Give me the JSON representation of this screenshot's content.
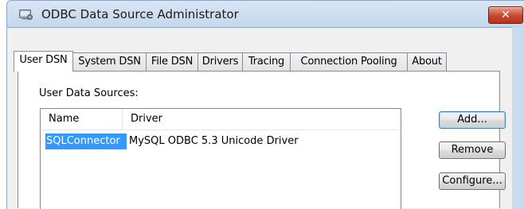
{
  "window": {
    "title": "ODBC Data Source Administrator",
    "close_glyph": "✕",
    "icon": "odbc-admin-icon"
  },
  "tabs": [
    {
      "label": "User DSN",
      "selected": true
    },
    {
      "label": "System DSN",
      "selected": false
    },
    {
      "label": "File DSN",
      "selected": false
    },
    {
      "label": "Drivers",
      "selected": false
    },
    {
      "label": "Tracing",
      "selected": false
    },
    {
      "label": "Connection Pooling",
      "selected": false
    },
    {
      "label": "About",
      "selected": false
    }
  ],
  "panel": {
    "section_label": "User Data Sources:",
    "list": {
      "columns": [
        "Name",
        "Driver"
      ],
      "rows": [
        {
          "name": "SQLConnector",
          "driver": "MySQL ODBC 5.3 Unicode Driver",
          "selected": true
        }
      ]
    },
    "buttons": {
      "add": "Add...",
      "remove": "Remove",
      "configure": "Configure..."
    }
  },
  "colors": {
    "selection": "#3399ff",
    "close_button": "#c9452c",
    "title_bar": "#c9dcef"
  }
}
